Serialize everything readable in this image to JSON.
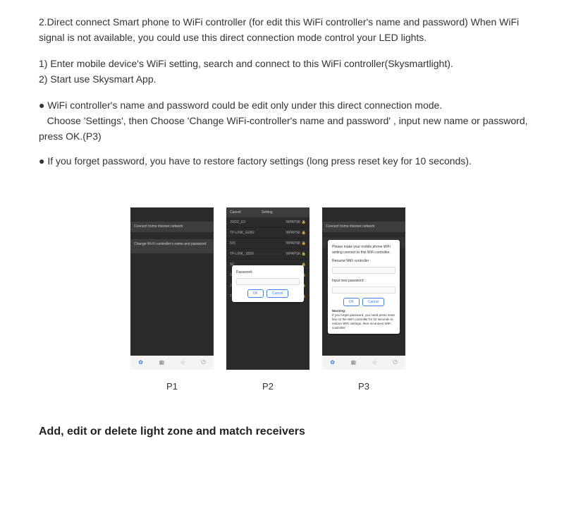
{
  "intro": {
    "p1": "2.Direct connect Smart phone to WiFi controller (for edit this WiFi controller's name and password)  When WiFi signal is not available, you could use this direct connection mode control your LED lights.",
    "p2a": "1) Enter mobile device's WiFi setting, search and connect to this WiFi controller(Skysmartlight).",
    "p2b": "2) Start use Skysmart App.",
    "b1a": "● WiFi controller's name and password could be edit only under this direct connection mode.",
    "b1b": "   Choose 'Settings', then Choose 'Change WiFi-controller's name and password' , input new name or password, press OK.(P3)",
    "b2": "● If you forget password, you have to restore factory settings (long press reset key for 10 seconds)."
  },
  "p1": {
    "menu1": "Connect home internet network",
    "menu2": "Change Wi-Fi controller's name and password"
  },
  "p2": {
    "cancel": "Cancel",
    "title": "Setting",
    "rows": [
      {
        "name": "JGDZ_EX",
        "sec": "WPAPSK"
      },
      {
        "name": "TP-LINK_EEB2",
        "sec": "WPAPSK"
      },
      {
        "name": "501",
        "sec": "WPAPSK"
      },
      {
        "name": "TP-LINK_1B99",
        "sec": "WPAPSK"
      }
    ],
    "modal_label": "Password:",
    "ok": "OK",
    "cancel_btn": "Cancel"
  },
  "p3": {
    "menu1": "Connect home internet network",
    "modal_top": "Please make your mobile phone WiFi setting connect to this WiFi controller.",
    "rename": "Rename WiFi controller :",
    "newpass": "Input new password :",
    "ok": "OK",
    "cancel": "Cancel",
    "warn_head": "Warning:",
    "warn_body": "If you forget password, you need press reset key on the WiFi controller for 10 seconds to restore WiFi settings, then reconnect WiFi controller."
  },
  "captions": {
    "c1": "P1",
    "c2": "P2",
    "c3": "P3"
  },
  "section_heading": "Add, edit or delete light zone and match receivers"
}
